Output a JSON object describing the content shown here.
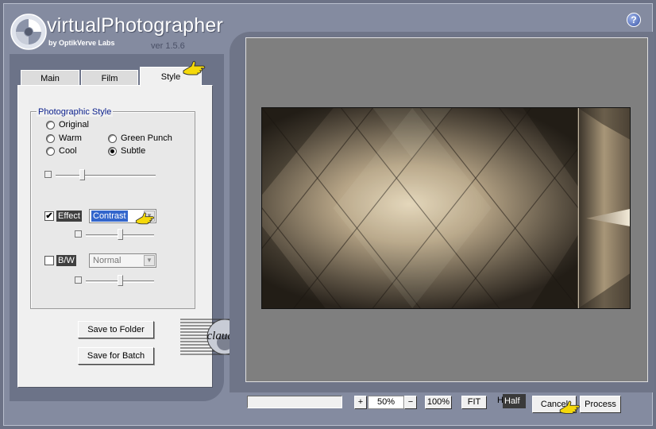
{
  "brand": {
    "title": "virtualPhotographer",
    "subtitle": "by OptikVerve Labs",
    "version": "ver 1.5.6",
    "help_label": "?"
  },
  "tabs": [
    {
      "label": "Main",
      "selected": false
    },
    {
      "label": "Film",
      "selected": false
    },
    {
      "label": "Style",
      "selected": true
    }
  ],
  "photographic_style": {
    "title": "Photographic Style",
    "options": [
      {
        "label": "Original",
        "selected": false
      },
      {
        "label": "Warm",
        "selected": false
      },
      {
        "label": "Green Punch",
        "selected": false
      },
      {
        "label": "Cool",
        "selected": false
      },
      {
        "label": "Subtle",
        "selected": true
      }
    ],
    "intensity_slider": 0.25
  },
  "effect": {
    "label": "Effect",
    "checked": true,
    "check_mark": "✔",
    "value": "Contrast",
    "slider": 0.5
  },
  "bw": {
    "label": "B/W",
    "checked": false,
    "value": "Normal",
    "slider": 0.5
  },
  "buttons": {
    "save_folder": "Save to Folder",
    "save_batch": "Save for Batch",
    "zoom_in": "+",
    "zoom_out": "−",
    "zoom_value": "50%",
    "zoom_100": "100%",
    "fit": "FIT",
    "half_prefix": "H",
    "half_value": "Half",
    "cancel": "Cancel",
    "process": "Process"
  },
  "watermark": {
    "text": "claudia"
  },
  "colors": {
    "accent_blue": "#0a1f8c",
    "highlight": "#3366cc",
    "hand_yellow": "#f5d90a",
    "photo_light": "#d8c7a9",
    "photo_dark": "#2e2820"
  },
  "icons": [
    "logo-swirl-icon",
    "help-icon",
    "pointing-hand-icon",
    "dropdown-arrow-icon"
  ]
}
